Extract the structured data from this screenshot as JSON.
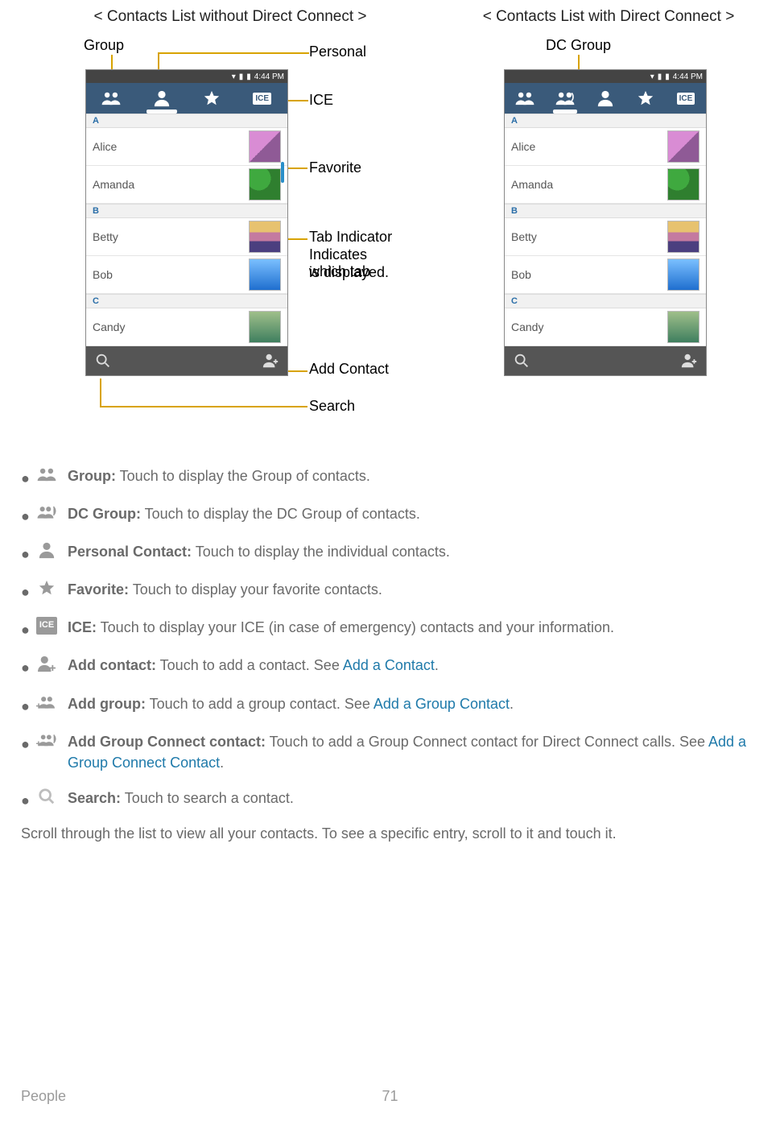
{
  "figures": {
    "left": {
      "title": "< Contacts List without Direct Connect >",
      "callouts": {
        "group": "Group",
        "personal": "Personal",
        "ice": "ICE",
        "favorite": "Favorite",
        "tab_indicator_line1": "Tab Indicator",
        "tab_indicator_line2": "Indicates which tab",
        "tab_indicator_line3": "is displayed.",
        "add_contact": "Add Contact",
        "search": "Search"
      }
    },
    "right": {
      "title": "< Contacts List with Direct Connect >",
      "callouts": {
        "dc_group": "DC Group"
      }
    },
    "status_time": "4:44 PM",
    "ice_label": "ICE",
    "sections": [
      {
        "letter": "A",
        "items": [
          "Alice",
          "Amanda"
        ]
      },
      {
        "letter": "B",
        "items": [
          "Betty",
          "Bob"
        ]
      },
      {
        "letter": "C",
        "items": [
          "Candy"
        ]
      }
    ]
  },
  "bullets": [
    {
      "bold": "Group:",
      "text": " Touch to display the Group of contacts."
    },
    {
      "bold": "DC Group:",
      "text": " Touch to display the DC Group of contacts."
    },
    {
      "bold": "Personal Contact:",
      "text": " Touch to display the individual contacts."
    },
    {
      "bold": "Favorite:",
      "text": " Touch to display your favorite contacts."
    },
    {
      "bold": "ICE:",
      "text": " Touch to display your ICE (in case of emergency) contacts and your information."
    },
    {
      "bold": "Add contact:",
      "text_before": " Touch to add a contact. See ",
      "link": "Add a Contact",
      "text_after": "."
    },
    {
      "bold": "Add group:",
      "text_before": " Touch to add a group contact. See ",
      "link": "Add a Group Contact",
      "text_after": "."
    },
    {
      "bold": "Add Group Connect contact:",
      "text_before": " Touch to add a Group Connect contact for Direct Connect calls. See ",
      "link": "Add a Group Connect Contact",
      "text_after": "."
    },
    {
      "bold": "Search:",
      "text": " Touch to search a contact."
    }
  ],
  "closing_paragraph": "Scroll through the list to view all your contacts. To see a specific entry, scroll to it and touch it.",
  "footer": {
    "section": "People",
    "page": "71"
  }
}
